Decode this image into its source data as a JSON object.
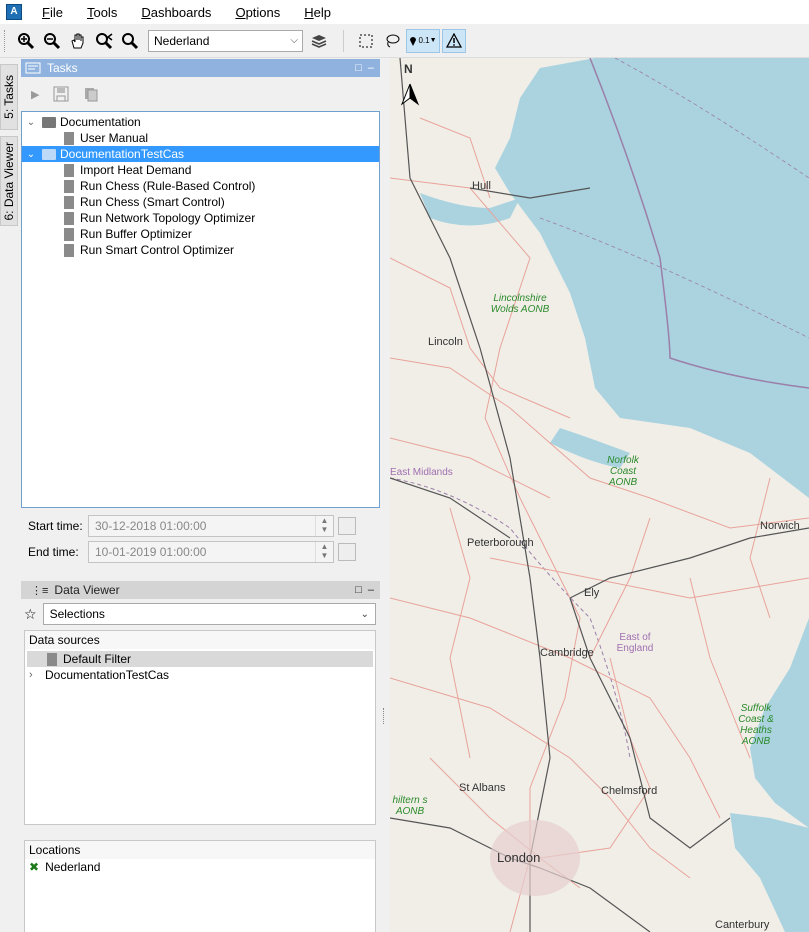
{
  "app": {
    "icon_text": "A"
  },
  "menu": [
    {
      "label": "File",
      "key": "F"
    },
    {
      "label": "Tools",
      "key": "T"
    },
    {
      "label": "Dashboards",
      "key": "D"
    },
    {
      "label": "Options",
      "key": "O"
    },
    {
      "label": "Help",
      "key": "H"
    }
  ],
  "toolbar": {
    "region_select": "Nederland",
    "zoom_badge": "0.1",
    "icons": [
      "zoom-in-icon",
      "zoom-out-icon",
      "pan-hand-icon",
      "zoom-previous-icon",
      "zoom-next-icon",
      "layers-icon",
      "rectangle-select-icon",
      "lasso-select-icon",
      "pin-scale-icon",
      "warning-icon"
    ]
  },
  "side_tabs": {
    "tasks": "5: Tasks",
    "data_viewer": "6: Data Viewer"
  },
  "tasks_panel": {
    "title": "Tasks",
    "tree": [
      {
        "label": "Documentation",
        "type": "folder",
        "level": 0,
        "expanded": true,
        "selected": false
      },
      {
        "label": "User Manual",
        "type": "doc",
        "level": 1,
        "selected": false
      },
      {
        "label": "DocumentationTestCas",
        "type": "folder",
        "level": 0,
        "expanded": true,
        "selected": true
      },
      {
        "label": "Import Heat Demand",
        "type": "doc",
        "level": 1,
        "selected": false
      },
      {
        "label": "Run Chess (Rule-Based Control)",
        "type": "doc",
        "level": 1,
        "selected": false
      },
      {
        "label": "Run Chess (Smart Control)",
        "type": "doc",
        "level": 1,
        "selected": false
      },
      {
        "label": "Run Network Topology Optimizer",
        "type": "doc",
        "level": 1,
        "selected": false
      },
      {
        "label": "Run Buffer Optimizer",
        "type": "doc",
        "level": 1,
        "selected": false
      },
      {
        "label": "Run Smart Control Optimizer",
        "type": "doc",
        "level": 1,
        "selected": false
      }
    ],
    "start_time_label": "Start time:",
    "start_time_value": "30-12-2018 01:00:00",
    "end_time_label": "End time:",
    "end_time_value": "10-01-2019 01:00:00"
  },
  "data_viewer": {
    "title": "Data Viewer",
    "selection": "Selections",
    "data_sources_title": "Data sources",
    "data_sources": [
      {
        "label": "Default Filter",
        "selected": true,
        "expandable": false
      },
      {
        "label": "DocumentationTestCas",
        "selected": false,
        "expandable": true
      }
    ],
    "locations_title": "Locations",
    "locations": [
      {
        "label": "Nederland"
      }
    ]
  },
  "map": {
    "north": "N",
    "labels": [
      {
        "text": "Hull",
        "kind": "city"
      },
      {
        "text": "Lincolnshire Wolds AONB",
        "kind": "green"
      },
      {
        "text": "Lincoln",
        "kind": "city"
      },
      {
        "text": "East Midlands",
        "kind": "purple"
      },
      {
        "text": "Norfolk Coast AONB",
        "kind": "green"
      },
      {
        "text": "Norwich",
        "kind": "city"
      },
      {
        "text": "Peterborough",
        "kind": "city"
      },
      {
        "text": "Ely",
        "kind": "city"
      },
      {
        "text": "East of England",
        "kind": "purple"
      },
      {
        "text": "Cambridge",
        "kind": "city"
      },
      {
        "text": "Suffolk Coast & Heaths AONB",
        "kind": "green"
      },
      {
        "text": "St Albans",
        "kind": "city"
      },
      {
        "text": "Chelmsford",
        "kind": "city"
      },
      {
        "text": "hiltern s AONB",
        "kind": "green"
      },
      {
        "text": "London",
        "kind": "city"
      },
      {
        "text": "Canterbury",
        "kind": "city"
      }
    ],
    "colors": {
      "sea": "#aad3df",
      "land": "#f1eee8",
      "road": "#e8a39a",
      "rail": "#555555",
      "boundary": "#9b7fa8"
    }
  }
}
